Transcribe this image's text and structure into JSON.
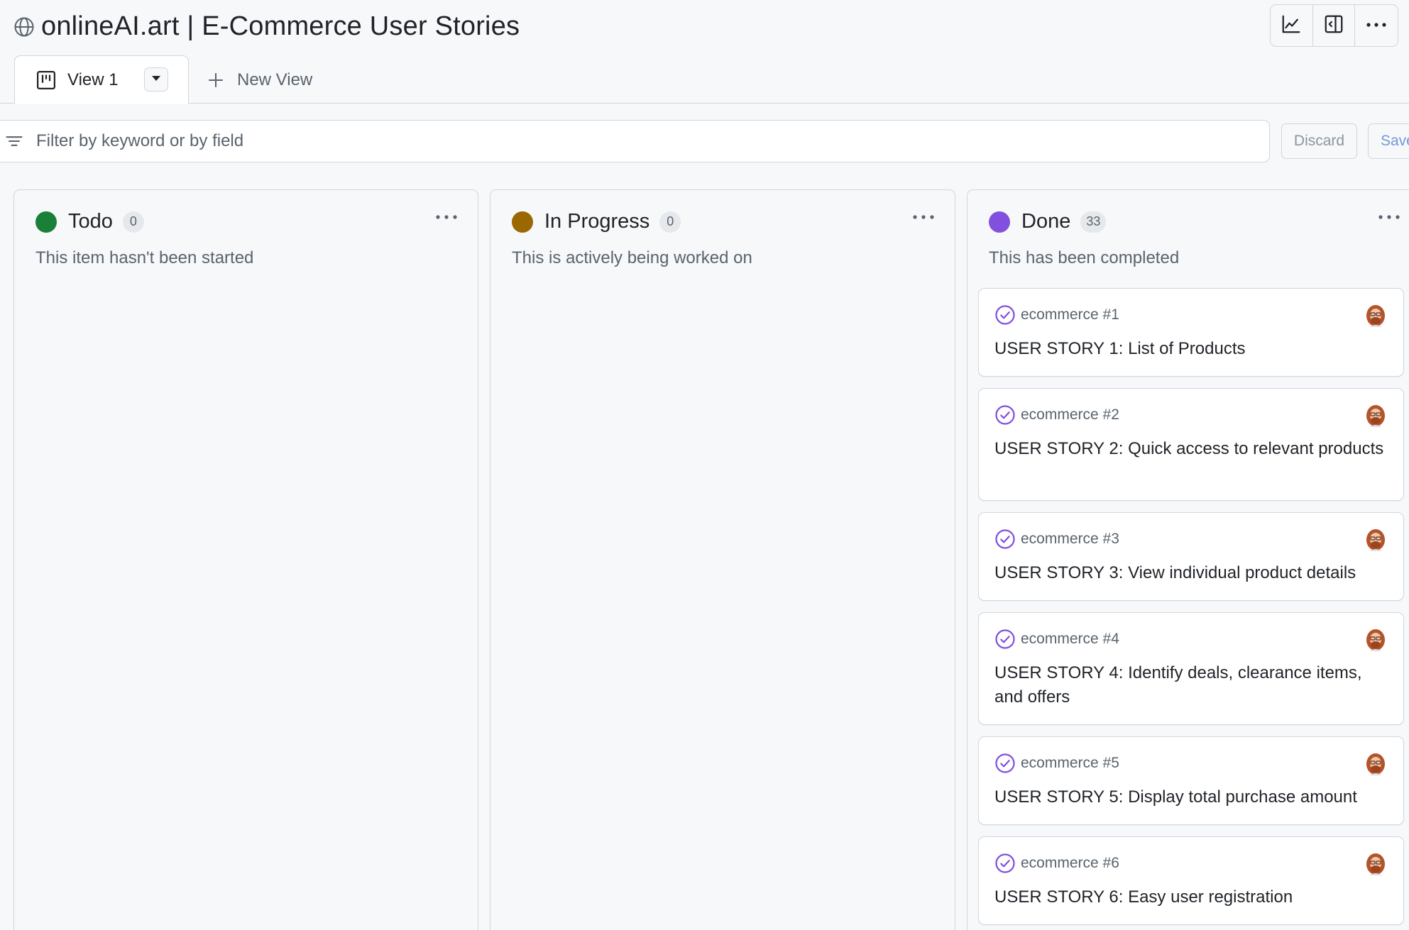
{
  "header": {
    "title": "onlineAI.art | E-Commerce User Stories",
    "icon": "globe-icon",
    "actions": [
      {
        "name": "insights-button",
        "icon": "graph-icon"
      },
      {
        "name": "sidepanel-button",
        "icon": "sidebar-collapse-icon"
      },
      {
        "name": "more-options-button",
        "icon": "kebab-horizontal-icon"
      }
    ]
  },
  "tabs": {
    "active": {
      "label": "View 1",
      "icon": "project-board-icon"
    },
    "new_view_label": "New View"
  },
  "filter": {
    "placeholder": "Filter by keyword or by field",
    "value": "",
    "discard_label": "Discard",
    "save_label": "Save"
  },
  "columns": [
    {
      "name": "Todo",
      "count": "0",
      "description": "This item hasn't been started",
      "color": "#1a7f37"
    },
    {
      "name": "In Progress",
      "count": "0",
      "description": "This is actively being worked on",
      "color": "#9a6700"
    },
    {
      "name": "Done",
      "count": "33",
      "description": "This has been completed",
      "color": "#8250df"
    }
  ],
  "done_cards": [
    {
      "ref": "ecommerce #1",
      "title": "USER STORY 1: List of Products"
    },
    {
      "ref": "ecommerce #2",
      "title": "USER STORY 2: Quick access to relevant products"
    },
    {
      "ref": "ecommerce #3",
      "title": "USER STORY 3: View individual product details"
    },
    {
      "ref": "ecommerce #4",
      "title": "USER STORY 4: Identify deals, clearance items, and offers"
    },
    {
      "ref": "ecommerce #5",
      "title": "USER STORY 5: Display total purchase amount"
    },
    {
      "ref": "ecommerce #6",
      "title": "USER STORY 6: Easy user registration"
    }
  ],
  "colors": {
    "border": "#d0d7de",
    "background": "#f6f8fa",
    "done_purple": "#8250df",
    "muted_text": "#59636e"
  }
}
